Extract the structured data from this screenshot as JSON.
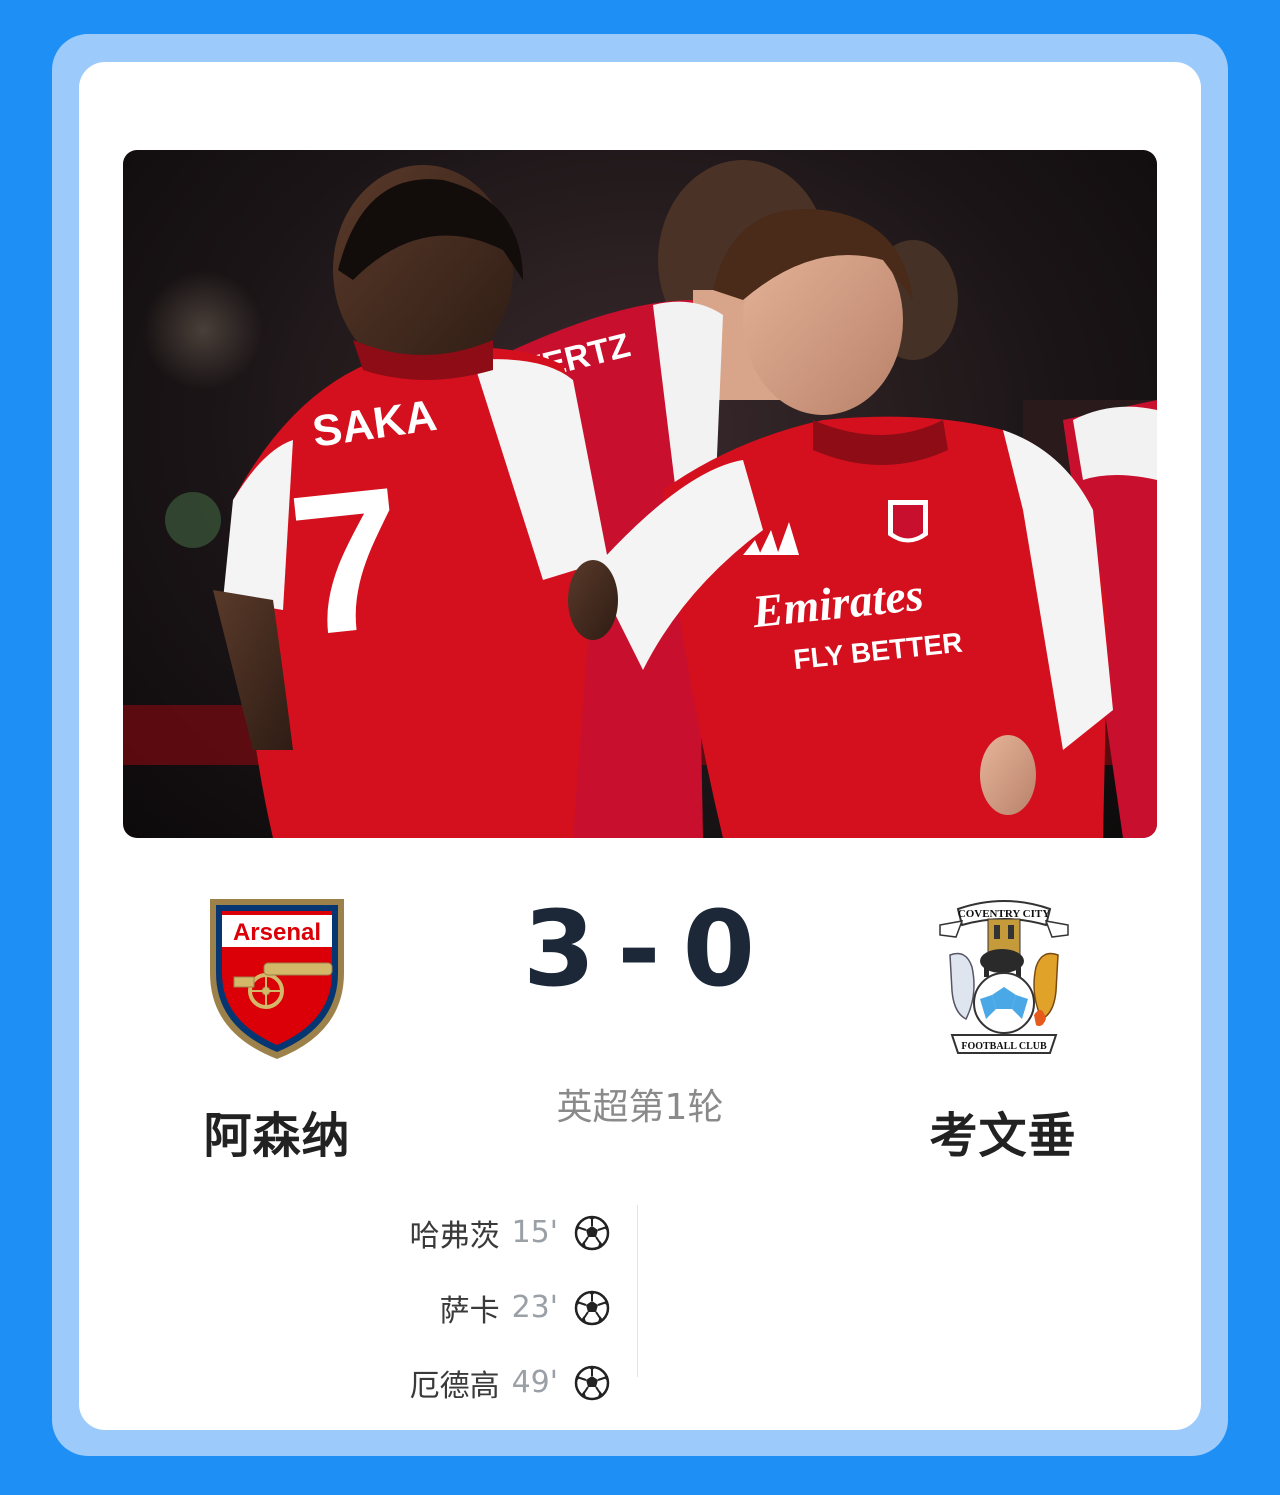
{
  "match": {
    "home_team": "阿森纳",
    "away_team": "考文垂",
    "home_score": "3",
    "separator": "-",
    "away_score": "0",
    "round": "英超第1轮"
  },
  "photo": {
    "jersey_name": "SAKA",
    "jersey_number": "7",
    "sponsor_line1": "Emirates",
    "sponsor_line2": "FLY BETTER",
    "back_name_partial": "VERTZ"
  },
  "home_crest": {
    "text": "Arsenal",
    "icon": "arsenal-crest"
  },
  "away_crest": {
    "top_text": "COVENTRY CITY",
    "bottom_text": "FOOTBALL CLUB",
    "icon": "coventry-crest"
  },
  "scorers": [
    {
      "name": "哈弗茨",
      "minute": "15'",
      "icon": "soccer-ball-icon"
    },
    {
      "name": "萨卡",
      "minute": "23'",
      "icon": "soccer-ball-icon"
    },
    {
      "name": "厄德高",
      "minute": "49'",
      "icon": "soccer-ball-icon"
    }
  ],
  "colors": {
    "background": "#1e8ff4",
    "frame": "#9ccbfb",
    "card": "#ffffff",
    "score": "#1c2838",
    "arsenal_red": "#db0007"
  }
}
